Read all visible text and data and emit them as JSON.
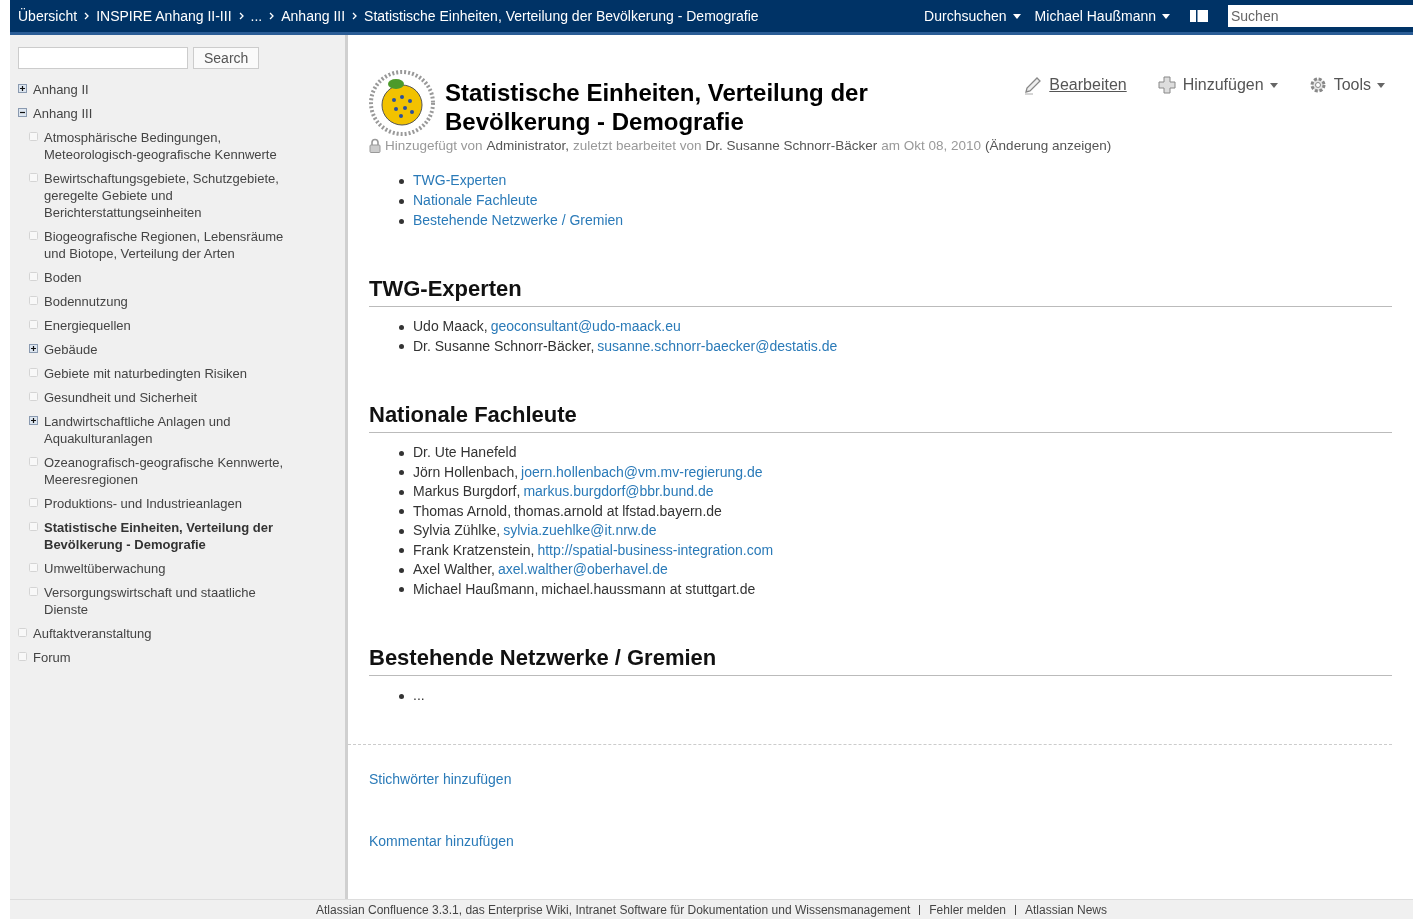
{
  "breadcrumb": [
    "Übersicht",
    "INSPIRE Anhang II-III",
    "...",
    "Anhang III",
    "Statistische Einheiten, Verteilung der Bevölkerung - Demografie"
  ],
  "topbar": {
    "menus": [
      "Durchsuchen",
      "Michael Haußmann"
    ],
    "search_placeholder": "Suchen"
  },
  "sidebar": {
    "search_button": "Search",
    "tree": [
      {
        "label": "Anhang II",
        "kind": "collapsed",
        "selected": false
      },
      {
        "label": "Anhang III",
        "kind": "expanded",
        "selected": false,
        "children": [
          {
            "label": "Atmosphärische Bedingungen, Meteorologisch-geografische Kennwerte",
            "kind": "leaf",
            "selected": false
          },
          {
            "label": "Bewirtschaftungsgebiete, Schutzgebiete, geregelte Gebiete und Berichterstattungseinheiten",
            "kind": "leaf",
            "selected": false
          },
          {
            "label": "Biogeografische Regionen, Lebensräume und Biotope, Verteilung der Arten",
            "kind": "leaf",
            "selected": false
          },
          {
            "label": "Boden",
            "kind": "leaf",
            "selected": false
          },
          {
            "label": "Bodennutzung",
            "kind": "leaf",
            "selected": false
          },
          {
            "label": "Energiequellen",
            "kind": "leaf",
            "selected": false
          },
          {
            "label": "Gebäude",
            "kind": "collapsed",
            "selected": false
          },
          {
            "label": "Gebiete mit naturbedingten Risiken",
            "kind": "leaf",
            "selected": false
          },
          {
            "label": "Gesundheit und Sicherheit",
            "kind": "leaf",
            "selected": false
          },
          {
            "label": "Landwirtschaftliche Anlagen und Aquakulturanlagen",
            "kind": "collapsed",
            "selected": false
          },
          {
            "label": "Ozeanografisch-geografische Kennwerte, Meeresregionen",
            "kind": "leaf",
            "selected": false
          },
          {
            "label": "Produktions- und Industrieanlagen",
            "kind": "leaf",
            "selected": false
          },
          {
            "label": "Statistische Einheiten, Verteilung der Bevölkerung - Demografie",
            "kind": "leaf",
            "selected": true
          },
          {
            "label": "Umweltüberwachung",
            "kind": "leaf",
            "selected": false
          },
          {
            "label": "Versorgungswirtschaft und staatliche Dienste",
            "kind": "leaf",
            "selected": false
          }
        ]
      },
      {
        "label": "Auftaktveranstaltung",
        "kind": "leaf",
        "selected": false
      },
      {
        "label": "Forum",
        "kind": "leaf",
        "selected": false
      }
    ]
  },
  "actions": [
    {
      "label": "Bearbeiten",
      "kind": "edit"
    },
    {
      "label": "Hinzufügen",
      "kind": "add"
    },
    {
      "label": "Tools",
      "kind": "tools"
    }
  ],
  "page": {
    "title": "Statistische Einheiten, Verteilung der Bevölkerung - Demografie",
    "meta": [
      {
        "text": "Hinzugefügt von",
        "kind": "label"
      },
      {
        "text": "Administrator,",
        "kind": "name"
      },
      {
        "text": "zuletzt bearbeitet von",
        "kind": "label"
      },
      {
        "text": "Dr. Susanne Schnorr-Bäcker",
        "kind": "name"
      },
      {
        "text": "am Okt 08, 2010",
        "kind": "label"
      },
      {
        "text": "(Änderung anzeigen)",
        "kind": "name"
      }
    ],
    "toc": [
      "TWG-Experten",
      "Nationale Fachleute",
      "Bestehende Netzwerke / Gremien"
    ],
    "sections": [
      {
        "heading": "TWG-Experten",
        "items": [
          {
            "name": "Udo Maack,",
            "contact": "geoconsultant@udo-maack.eu",
            "kind": "link"
          },
          {
            "name": "Dr. Susanne Schnorr-Bäcker,",
            "contact": "susanne.schnorr-baecker@destatis.de",
            "kind": "link"
          }
        ]
      },
      {
        "heading": "Nationale Fachleute",
        "items": [
          {
            "name": "Dr. Ute Hanefeld",
            "kind": "plain"
          },
          {
            "name": "Jörn Hollenbach,",
            "contact": "joern.hollenbach@vm.mv-regierung.de",
            "kind": "link"
          },
          {
            "name": "Markus Burgdorf,",
            "contact": "markus.burgdorf@bbr.bund.de",
            "kind": "link"
          },
          {
            "name": "Thomas Arnold,",
            "contact": "thomas.arnold at lfstad.bayern.de",
            "kind": "text"
          },
          {
            "name": "Sylvia Zühlke,",
            "contact": "sylvia.zuehlke@it.nrw.de",
            "kind": "link"
          },
          {
            "name": "Frank Kratzenstein,",
            "contact": "http://spatial-business-integration.com",
            "kind": "link"
          },
          {
            "name": "Axel Walther,",
            "contact": "axel.walther@oberhavel.de",
            "kind": "link"
          },
          {
            "name": "Michael Haußmann,",
            "contact": "michael.haussmann at stuttgart.de",
            "kind": "text"
          }
        ]
      },
      {
        "heading": "Bestehende Netzwerke / Gremien",
        "items": [
          {
            "name": "...",
            "kind": "plain"
          }
        ]
      }
    ],
    "labels_link": "Stichwörter hinzufügen",
    "comment_link": "Kommentar hinzufügen"
  },
  "footer": [
    "Atlassian Confluence 3.3.1, das Enterprise Wiki, Intranet Software für Dokumentation und Wissensmanagement",
    "Fehler melden",
    "Atlassian News"
  ]
}
